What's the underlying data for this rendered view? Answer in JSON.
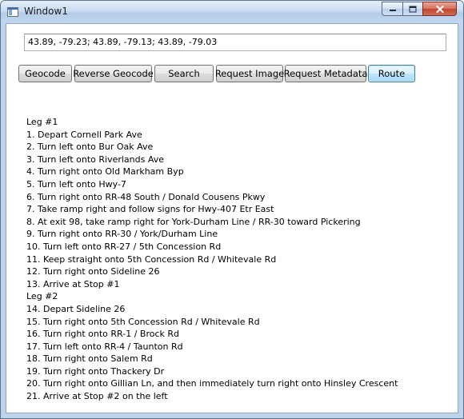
{
  "window": {
    "title": "Window1",
    "caption_buttons": {
      "minimize": "minimize",
      "maximize": "maximize",
      "close": "close"
    }
  },
  "input": {
    "value": "43.89, -79.23; 43.89, -79.13; 43.89, -79.03"
  },
  "buttons": {
    "geocode": "Geocode",
    "reverse_geocode": "Reverse Geocode",
    "search": "Search",
    "request_image": "Request Image",
    "request_metadata": "Request Metadata",
    "route": "Route"
  },
  "output_lines": [
    "Leg #1",
    "1. Depart Cornell Park Ave",
    "2. Turn left onto Bur Oak Ave",
    "3. Turn left onto Riverlands Ave",
    "4. Turn right onto Old Markham Byp",
    "5. Turn left onto Hwy-7",
    "6. Turn right onto RR-48 South / Donald Cousens Pkwy",
    "7. Take ramp right and follow signs for Hwy-407 Etr East",
    "8. At exit 98, take ramp right for York-Durham Line / RR-30 toward Pickering",
    "9. Turn right onto RR-30 / York/Durham Line",
    "10. Turn left onto RR-27 / 5th Concession Rd",
    "11. Keep straight onto 5th Concession Rd / Whitevale Rd",
    "12. Turn right onto Sideline 26",
    "13. Arrive at Stop #1",
    "Leg #2",
    "14. Depart Sideline 26",
    "15. Turn right onto 5th Concession Rd / Whitevale Rd",
    "16. Turn right onto RR-1 / Brock Rd",
    "17. Turn left onto RR-4 / Taunton Rd",
    "18. Turn right onto Salem Rd",
    "19. Turn right onto Thackery Dr",
    "20. Turn right onto Gillian Ln, and then immediately turn right onto Hinsley Crescent",
    "21. Arrive at Stop #2 on the left"
  ],
  "colors": {
    "frame": "#bfd3ea",
    "close_button": "#c2442d",
    "focused_button": "#bee6fd"
  }
}
